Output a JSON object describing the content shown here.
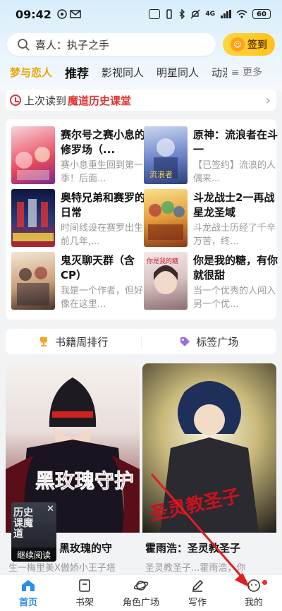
{
  "status": {
    "time": "09:42",
    "battery": "60",
    "signal": "4G"
  },
  "search": {
    "placeholder": "喜人：执子之手"
  },
  "sign_in": {
    "label": "签到"
  },
  "tabs": [
    "梦与恋人",
    "推荐",
    "影视同人",
    "明星同人",
    "动漫"
  ],
  "more": "≡ 更多",
  "last_read": {
    "label": "上次读到",
    "book": "魔道历史课堂"
  },
  "grid": [
    {
      "title": "赛尔号之赛小息的修罗场（...",
      "desc": "赛小息重生回到第一季！后面...",
      "color": "#e94b5c"
    },
    {
      "title": "原神：流浪者在斗一",
      "desc": "【已签约】流浪的人偶来...",
      "color": "#4a66b8"
    },
    {
      "title": "奥特兄弟和赛罗的日常",
      "desc": "时间线设在赛罗出生前几年,...",
      "color": "#2b3a7a"
    },
    {
      "title": "斗龙战士2一再战星龙圣域",
      "desc": "斗龙战士历经了千辛万苦，终...",
      "color": "#c8702a"
    },
    {
      "title": "鬼灭聊天群（含CP）",
      "desc": "我是一个作者，但好像在这里...",
      "color": "#c9a27a"
    },
    {
      "title": "你是我的糖，有你就很甜",
      "desc": "当一个优秀的人闯入另一个优...",
      "color": "#b08a8f"
    }
  ],
  "rank": {
    "left": "书籍周排行",
    "right": "标签广场"
  },
  "featured": [
    {
      "title": "黑玫瑰的守",
      "desc": "生一梅里美X傲娇小王子塔",
      "cover_text": "黑玫瑰守护"
    },
    {
      "title": "霍雨浩：圣灵教圣子",
      "desc": "圣灵教圣子...霍雨浩，你",
      "cover_text": "圣灵教圣子"
    }
  ],
  "floater": {
    "title": "历史课魔道",
    "continue": "继续阅读"
  },
  "nav": [
    "首页",
    "书架",
    "角色广场",
    "写作",
    "我的"
  ]
}
